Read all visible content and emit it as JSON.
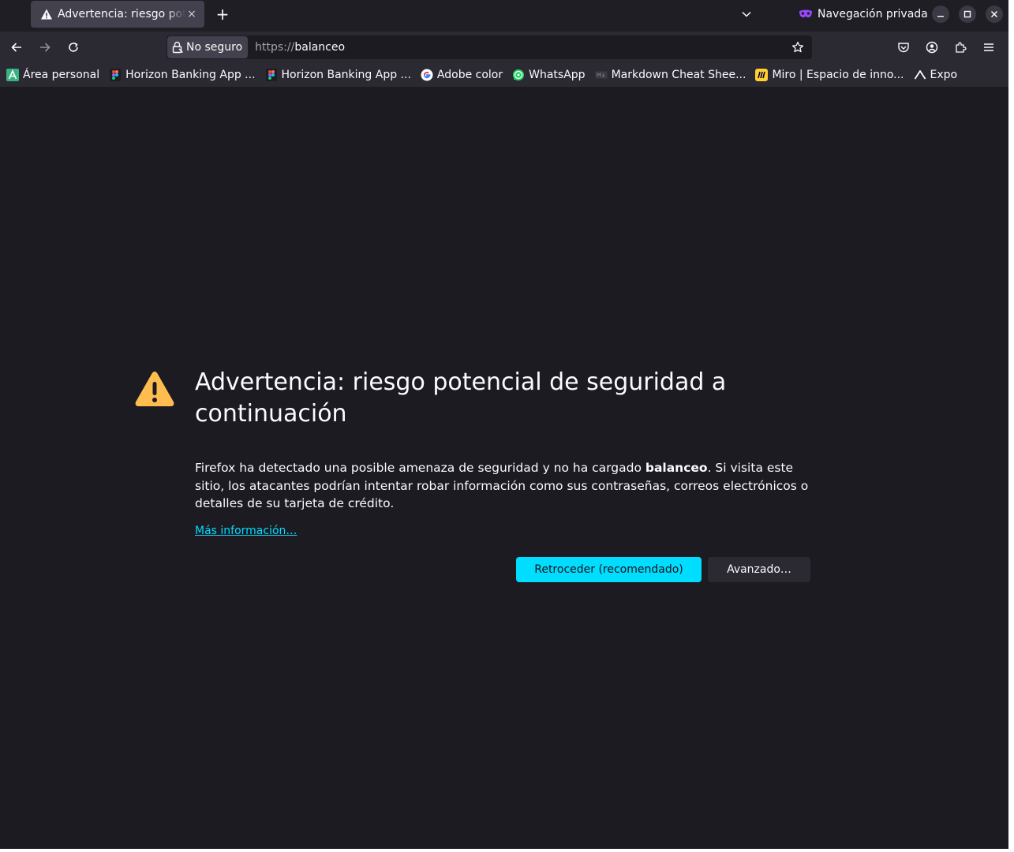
{
  "tab": {
    "title": "Advertencia: riesgo potencial de seguridad a continuación",
    "close": "×"
  },
  "tabstrip": {
    "new_tab": "+",
    "private_label": "Navegación privada"
  },
  "navbar": {
    "identity_label": "No seguro",
    "url_scheme": "https://",
    "url_host": "balanceo"
  },
  "bookmarks": [
    {
      "label": "Área personal",
      "icon": "atlassian-icon",
      "color": "#36b37e"
    },
    {
      "label": "Horizon Banking App ...",
      "icon": "figma-icon",
      "color": "#1e1e1e"
    },
    {
      "label": "Horizon Banking App ...",
      "icon": "figma-icon",
      "color": "#1e1e1e"
    },
    {
      "label": "Adobe color",
      "icon": "google-icon",
      "color": "#ffffff"
    },
    {
      "label": "WhatsApp",
      "icon": "whatsapp-icon",
      "color": "#25d366"
    },
    {
      "label": "Markdown Cheat Shee...",
      "icon": "markdown-icon",
      "color": "#3c3b44"
    },
    {
      "label": "Miro | Espacio de inno...",
      "icon": "miro-icon",
      "color": "#ffd02f"
    },
    {
      "label": "Expo",
      "icon": "expo-icon",
      "color": "#fbfbfe"
    }
  ],
  "page": {
    "title": "Advertencia: riesgo potencial de seguridad a continuación",
    "desc_before": "Firefox ha detectado una posible amenaza de seguridad y no ha cargado ",
    "desc_host": "balanceo",
    "desc_after": ". Si visita este sitio, los atacantes podrían intentar robar información como sus contraseñas, correos electrónicos o detalles de su tarjeta de crédito.",
    "more_info": "Más información…",
    "go_back": "Retroceder (recomendado)",
    "advanced": "Avanzado…"
  },
  "colors": {
    "accent": "#00ddff",
    "warning": "#ffbd4f",
    "background": "#1c1b22"
  }
}
